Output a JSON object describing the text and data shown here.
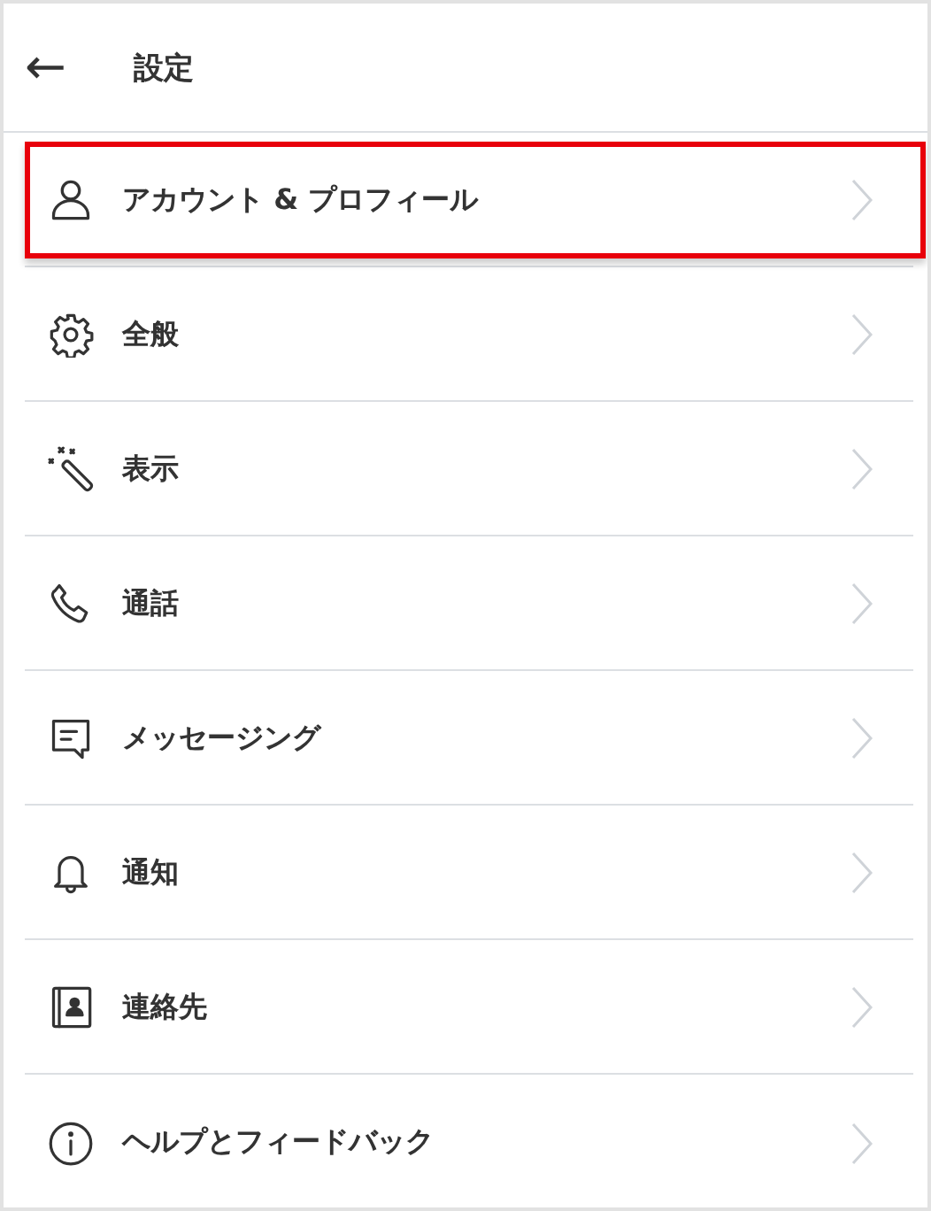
{
  "header": {
    "back": "←",
    "title": "設定"
  },
  "items": [
    {
      "kind": "account",
      "label": "アカウント & プロフィール",
      "selected": true
    },
    {
      "kind": "general",
      "label": "全般",
      "selected": false
    },
    {
      "kind": "display",
      "label": "表示",
      "selected": false
    },
    {
      "kind": "calls",
      "label": "通話",
      "selected": false
    },
    {
      "kind": "messaging",
      "label": "メッセージング",
      "selected": false
    },
    {
      "kind": "notifications",
      "label": "通知",
      "selected": false
    },
    {
      "kind": "contacts",
      "label": "連絡先",
      "selected": false
    },
    {
      "kind": "help",
      "label": "ヘルプとフィードバック",
      "selected": false
    }
  ]
}
